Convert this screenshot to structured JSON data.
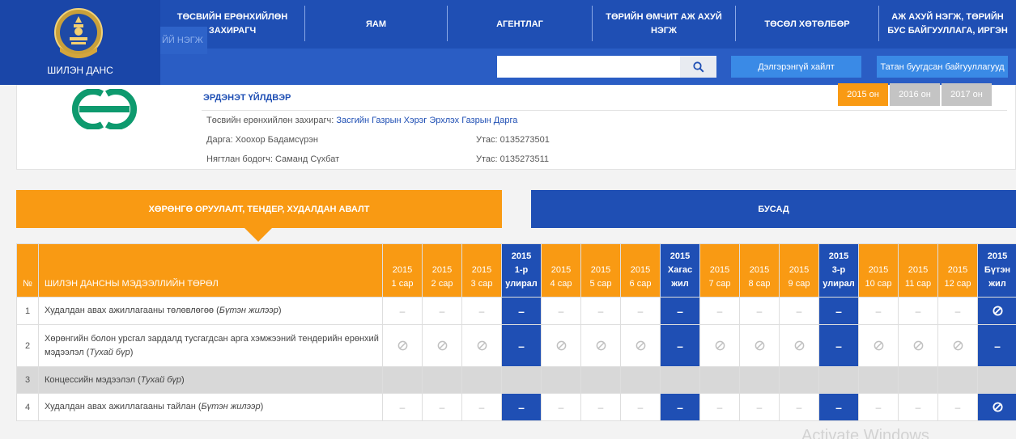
{
  "logo": {
    "text": "ШИЛЭН ДАНС",
    "emblem_icon": "soyombo-emblem-icon"
  },
  "ghost_tab": "ЙЙ НЭГЖ",
  "menu": [
    {
      "label": "ТӨСВИЙН ЕРӨНХИЙЛӨН ЗАХИРАГЧ"
    },
    {
      "label": "ЯАМ"
    },
    {
      "label": "АГЕНТЛАГ"
    },
    {
      "label": "ТӨРИЙН ӨМЧИТ АЖ АХУЙ НЭГЖ"
    },
    {
      "label": "ТӨСӨЛ ХӨТӨЛБӨР"
    },
    {
      "label": "АЖ АХУЙ НЭГЖ, ТӨРИЙН БУС БАЙГУУЛЛАГА, ИРГЭН"
    }
  ],
  "search": {
    "placeholder": "",
    "icon": "search-icon"
  },
  "buttons": {
    "advanced_search": "Дэлгэрэнгүй хайлт",
    "financed_orgs": "Татан буугдсан байгууллагууд"
  },
  "colors": {
    "nav_blue": "#1f4fb4",
    "accent_orange": "#f99a13",
    "org_logo_green": "#0e9a6e",
    "year_inactive": "#c4c4c4"
  },
  "org": {
    "name": "ЭРДЭНЭТ ҮЙЛДВЭР",
    "budget_manager_label": "Төсвийн ерөнхийлөн захирагч:",
    "budget_manager_value": "Засгийн Газрын Хэрэг Эрхлэх Газрын Дарга",
    "director": "Дарга: Хоохор Бадамсүрэн",
    "director_phone": "Утас: 0135273501",
    "accountant": "Нягтлан бодогч: Саманд Сүхбат",
    "accountant_phone": "Утас: 0135273511",
    "years": [
      {
        "label": "2015 он",
        "active": true
      },
      {
        "label": "2016 он",
        "active": false
      },
      {
        "label": "2017 он",
        "active": false
      }
    ]
  },
  "tabs": {
    "procurement": "ХӨРӨНГӨ ОРУУЛАЛТ, ТЕНДЕР, ХУДАЛДАН АВАЛТ",
    "other": "БУСАД"
  },
  "table": {
    "no_header": "№",
    "type_header": "ШИЛЭН ДАНСНЫ МЭДЭЭЛЛИЙН ТӨРӨЛ",
    "period_headers": [
      {
        "year": "2015",
        "label": "1 сар",
        "quarter": false
      },
      {
        "year": "2015",
        "label": "2 сар",
        "quarter": false
      },
      {
        "year": "2015",
        "label": "3 сар",
        "quarter": false
      },
      {
        "year": "2015",
        "label": "1-р улирал",
        "quarter": true
      },
      {
        "year": "2015",
        "label": "4 сар",
        "quarter": false
      },
      {
        "year": "2015",
        "label": "5 сар",
        "quarter": false
      },
      {
        "year": "2015",
        "label": "6 сар",
        "quarter": false
      },
      {
        "year": "2015",
        "label": "Хагас жил",
        "quarter": true
      },
      {
        "year": "2015",
        "label": "7 сар",
        "quarter": false
      },
      {
        "year": "2015",
        "label": "8 сар",
        "quarter": false
      },
      {
        "year": "2015",
        "label": "9 сар",
        "quarter": false
      },
      {
        "year": "2015",
        "label": "3-р улирал",
        "quarter": true
      },
      {
        "year": "2015",
        "label": "10 сар",
        "quarter": false
      },
      {
        "year": "2015",
        "label": "11 сар",
        "quarter": false
      },
      {
        "year": "2015",
        "label": "12 сар",
        "quarter": false
      },
      {
        "year": "2015",
        "label": "Бүтэн жил",
        "quarter": true
      }
    ],
    "rows": [
      {
        "no": "1",
        "name": "Худалдан авах ажиллагааны төлөвлөгөө",
        "note": "Бүтэн жилээр",
        "gray": false,
        "cells": [
          "dash",
          "dash",
          "dash",
          "dash",
          "dash",
          "dash",
          "dash",
          "dash",
          "dash",
          "dash",
          "dash",
          "dash",
          "dash",
          "dash",
          "dash",
          "na"
        ]
      },
      {
        "no": "2",
        "name": "Хөрөнгийн болон урсгал зардалд тусгагдсан арга хэмжээний тендерийн ерөнхий мэдээлэл",
        "note": "Тухай бүр",
        "gray": false,
        "cells": [
          "na",
          "na",
          "na",
          "dash",
          "na",
          "na",
          "na",
          "dash",
          "na",
          "na",
          "na",
          "dash",
          "na",
          "na",
          "na",
          "dash"
        ]
      },
      {
        "no": "3",
        "name": "Концессийн мэдээлэл",
        "note": "Тухай бүр",
        "gray": true,
        "cells": [
          "",
          "",
          "",
          "",
          "",
          "",
          "",
          "",
          "",
          "",
          "",
          "",
          "",
          "",
          "",
          ""
        ]
      },
      {
        "no": "4",
        "name": "Худалдан авах ажиллагааны тайлан",
        "note": "Бүтэн жилээр",
        "gray": false,
        "cells": [
          "dash",
          "dash",
          "dash",
          "dash",
          "dash",
          "dash",
          "dash",
          "dash",
          "dash",
          "dash",
          "dash",
          "dash",
          "dash",
          "dash",
          "dash",
          "na"
        ]
      }
    ],
    "dash_symbol": "–",
    "na_icon": "not-available-icon"
  },
  "watermark": "Activate Windows"
}
